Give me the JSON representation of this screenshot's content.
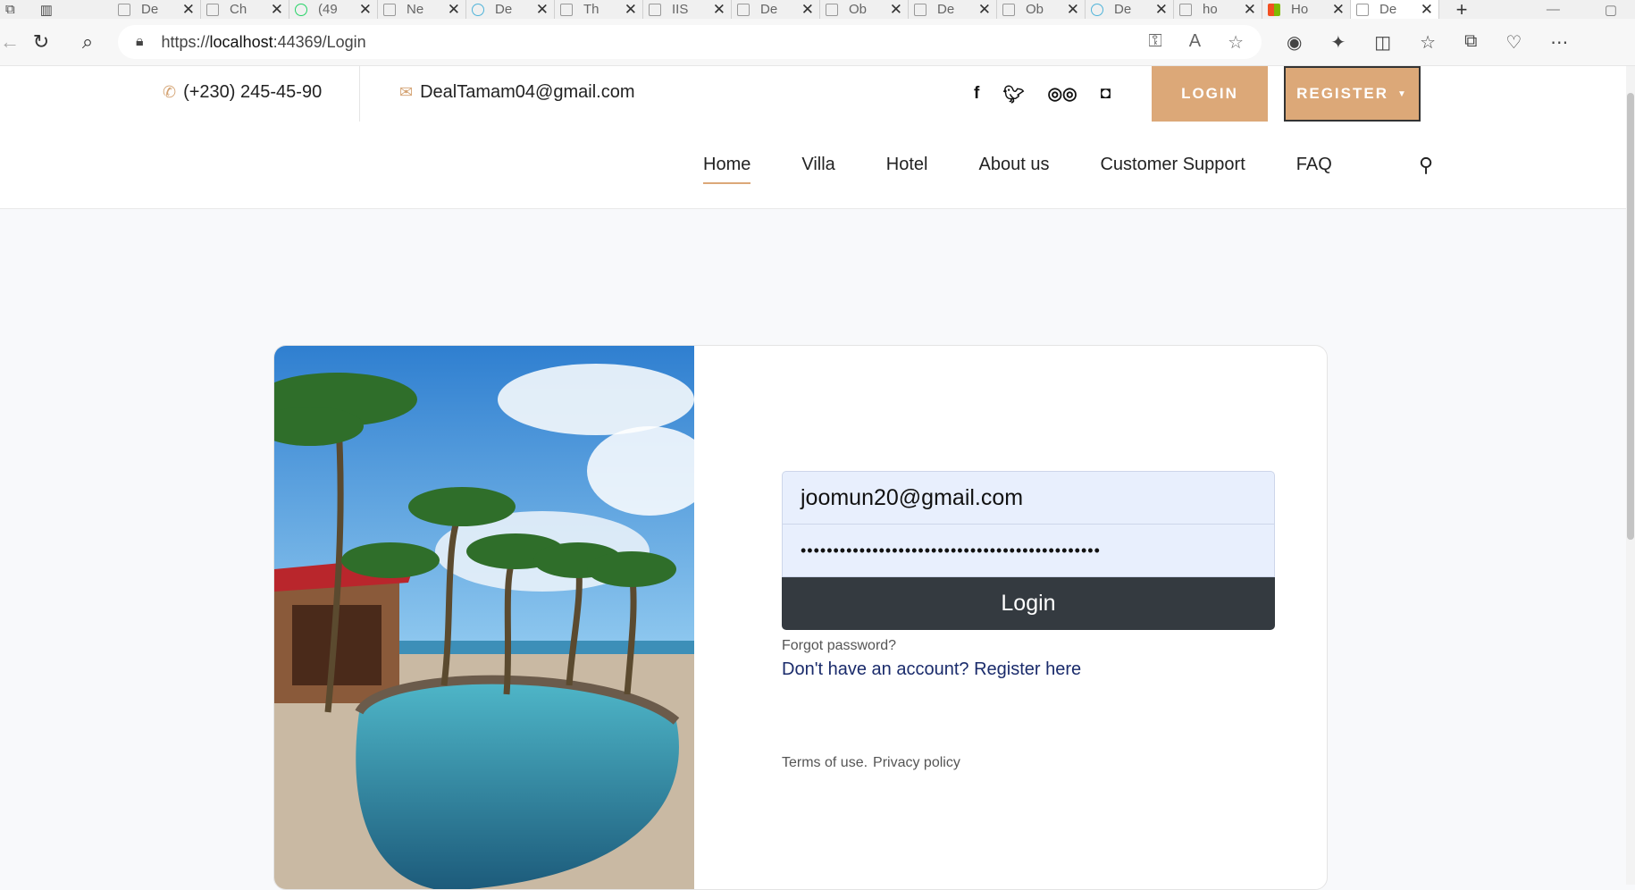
{
  "browser": {
    "tabs": [
      {
        "label": "De"
      },
      {
        "label": "Ch"
      },
      {
        "label": "(49"
      },
      {
        "label": "Ne"
      },
      {
        "label": "De"
      },
      {
        "label": "Th"
      },
      {
        "label": "IIS"
      },
      {
        "label": "De"
      },
      {
        "label": "Ob"
      },
      {
        "label": "De"
      },
      {
        "label": "Ob"
      },
      {
        "label": "De"
      },
      {
        "label": "ho"
      },
      {
        "label": "Ho"
      },
      {
        "label": "De"
      }
    ],
    "url_prefix": "https://",
    "url_host": "localhost",
    "url_rest": ":44369/Login"
  },
  "topbar": {
    "phone": "(+230) 245-45-90",
    "email": "DealTamam04@gmail.com",
    "login_label": "LOGIN",
    "register_label": "REGISTER"
  },
  "nav": {
    "items": [
      {
        "label": "Home"
      },
      {
        "label": "Villa"
      },
      {
        "label": "Hotel"
      },
      {
        "label": "About us"
      },
      {
        "label": "Customer Support"
      },
      {
        "label": "FAQ"
      }
    ]
  },
  "login_form": {
    "email_value": "joomun20@gmail.com",
    "password_mask": "••••••••••••••••••••••••••••••••••••••••••••••",
    "submit_label": "Login",
    "forgot_label": "Forgot password?",
    "register_prompt": "Don't have an account? Register here",
    "terms_label": "Terms of use.",
    "privacy_label": "Privacy policy"
  },
  "colors": {
    "accent": "#dca878",
    "dark_button": "#343a40",
    "input_bg": "#e8effd",
    "link": "#1a2b6b"
  }
}
